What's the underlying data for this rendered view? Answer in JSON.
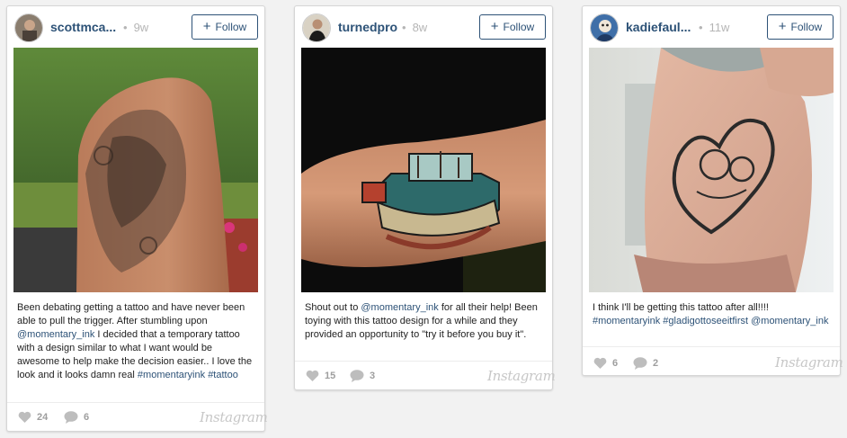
{
  "posts": [
    {
      "username": "scottmca...",
      "time_dot": "•",
      "time": "9w",
      "follow_label": "Follow",
      "caption_parts": [
        {
          "type": "text",
          "value": "Been debating getting a tattoo and have never been able to pull the trigger. After stumbling upon "
        },
        {
          "type": "mention",
          "value": "@momentary_ink"
        },
        {
          "type": "text",
          "value": " I decided that a temporary tattoo with a design similar to what I want would be awesome to help make the decision easier.. I love the look and it looks damn real "
        },
        {
          "type": "tag",
          "value": "#momentaryink"
        },
        {
          "type": "text",
          "value": " "
        },
        {
          "type": "tag",
          "value": "#tattoo"
        }
      ],
      "likes": "24",
      "comments": "6",
      "brand": "Instagram",
      "icons": {
        "like": "heart-icon",
        "comment": "comment-bubble-icon"
      }
    },
    {
      "username": "turnedpro",
      "time_dot": "•",
      "time": "8w",
      "follow_label": "Follow",
      "caption_parts": [
        {
          "type": "text",
          "value": "Shout out to "
        },
        {
          "type": "mention",
          "value": "@momentary_ink"
        },
        {
          "type": "text",
          "value": " for all their help! Been toying with this tattoo design for a while and they provided an opportunity to \"try it before you buy it\"."
        }
      ],
      "likes": "15",
      "comments": "3",
      "brand": "Instagram",
      "icons": {
        "like": "heart-icon",
        "comment": "comment-bubble-icon"
      }
    },
    {
      "username": "kadiefaul...",
      "time_dot": "•",
      "time": "11w",
      "follow_label": "Follow",
      "caption_parts": [
        {
          "type": "text",
          "value": "I think I'll be getting this tattoo after all!!!! "
        },
        {
          "type": "tag",
          "value": "#momentaryink"
        },
        {
          "type": "text",
          "value": " "
        },
        {
          "type": "tag",
          "value": "#gladigottoseeitfirst"
        },
        {
          "type": "text",
          "value": " "
        },
        {
          "type": "mention",
          "value": "@momentary_ink"
        }
      ],
      "likes": "6",
      "comments": "2",
      "brand": "Instagram",
      "icons": {
        "like": "heart-icon",
        "comment": "comment-bubble-icon"
      }
    }
  ],
  "colors": {
    "link": "#2d5277",
    "muted": "#9e9e9e",
    "background": "#f2f2f2"
  }
}
